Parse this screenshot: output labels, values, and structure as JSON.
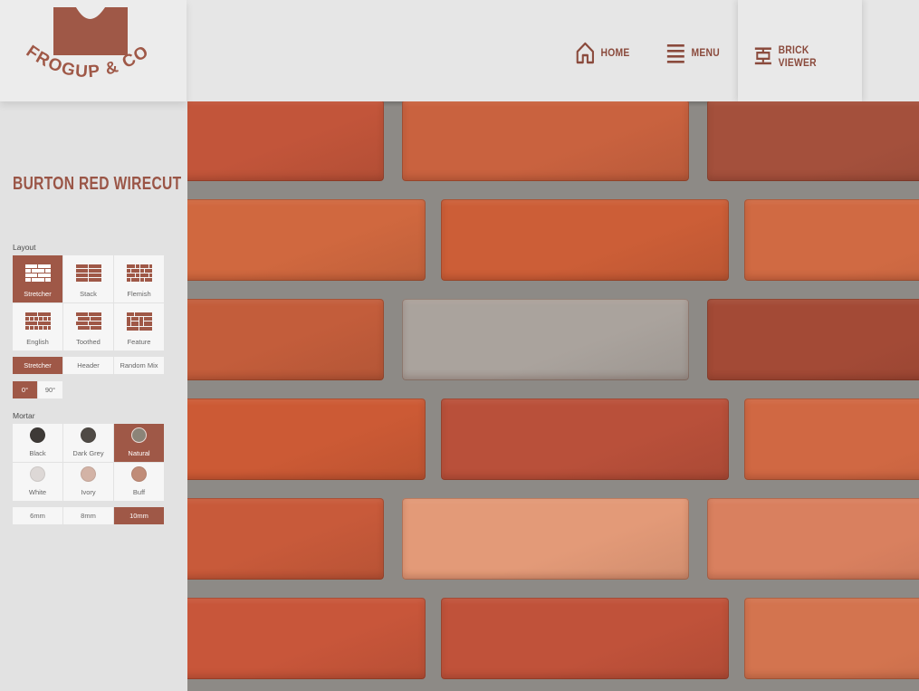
{
  "brand": {
    "logo_text": "FROGUP & CO",
    "color": "#9f5847"
  },
  "nav": {
    "home_label": "HOME",
    "menu_label": "MENU",
    "viewer_label": "BRICK VIEWER"
  },
  "product": {
    "title": "BURTON RED WIRECUT"
  },
  "layout": {
    "label": "Layout",
    "options": [
      {
        "label": "Stretcher",
        "icon": "stretcher-bond-icon",
        "active": true
      },
      {
        "label": "Stack",
        "icon": "stack-bond-icon",
        "active": false
      },
      {
        "label": "Flemish",
        "icon": "flemish-bond-icon",
        "active": false
      },
      {
        "label": "English",
        "icon": "english-bond-icon",
        "active": false
      },
      {
        "label": "Toothed",
        "icon": "toothed-bond-icon",
        "active": false
      },
      {
        "label": "Feature",
        "icon": "feature-bond-icon",
        "active": false
      }
    ],
    "patterns": [
      {
        "label": "Stretcher",
        "active": true
      },
      {
        "label": "Header",
        "active": false
      },
      {
        "label": "Random Mix",
        "active": false
      }
    ],
    "angles": [
      {
        "label": "0°",
        "active": true
      },
      {
        "label": "90°",
        "active": false
      }
    ]
  },
  "mortar": {
    "label": "Mortar",
    "colors": [
      {
        "label": "Black",
        "color": "#3e3a37",
        "active": false
      },
      {
        "label": "Dark Grey",
        "color": "#4f4a45",
        "active": false
      },
      {
        "label": "Natural",
        "color": "#8b8478",
        "active": true
      },
      {
        "label": "White",
        "color": "#ddd8d6",
        "active": false
      },
      {
        "label": "Ivory",
        "color": "#d3b3a6",
        "active": false
      },
      {
        "label": "Buff",
        "color": "#c08c78",
        "active": false
      }
    ],
    "thickness": [
      {
        "label": "6mm",
        "active": false
      },
      {
        "label": "8mm",
        "active": false
      },
      {
        "label": "10mm",
        "active": true
      }
    ]
  },
  "brick_wall": {
    "mortar_color": "#8d8a86",
    "courses": [
      [
        "#c2553a",
        "#c9623f",
        "#a4503c"
      ],
      [
        "#d0683f",
        "#cc5e37",
        "#d06a43",
        "#c9623f"
      ],
      [
        "#c35d3b",
        "#aaa39d",
        "#a34a36"
      ],
      [
        "#cc5a35",
        "#b9503a",
        "#d06843",
        "#c9623f"
      ],
      [
        "#c85a3a",
        "#e39a78",
        "#d9805f"
      ],
      [
        "#c8563a",
        "#c0523a",
        "#d3744f",
        "#cc6340"
      ]
    ]
  }
}
